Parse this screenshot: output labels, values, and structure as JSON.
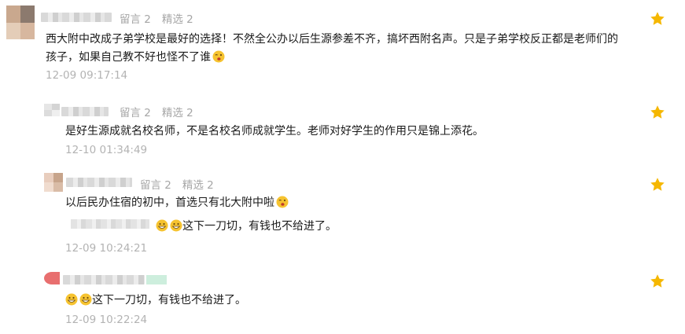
{
  "icons": {
    "star": "star-icon",
    "wink": "wink-emoji-icon",
    "grin": "grin-emoji-icon"
  },
  "colors": {
    "star": "#F5B700",
    "meta": "#A6A6A6",
    "text": "#1A1A1A",
    "emoji": "#F6C330"
  },
  "comments": [
    {
      "meta": {
        "messages": "留言 2",
        "picks": "精选 2"
      },
      "text": "西大附中改成子弟学校是最好的选择！不然全公办以后生源参差不齐，搞坏西附名声。只是子弟学校反正都是老师们的孩子，如果自己教不好也怪不了谁",
      "time": "12-09 09:17:14"
    },
    {
      "meta": {
        "messages": "留言 2",
        "picks": "精选 2"
      },
      "text": "是好生源成就名校名师，不是名校名师成就学生。老师对好学生的作用只是锦上添花。",
      "time": "12-10 01:34:49"
    },
    {
      "meta": {
        "messages": "留言 2",
        "picks": "精选 2"
      },
      "text": "以后民办住宿的初中，首选只有北大附中啦",
      "reply": "这下一刀切，有钱也不给进了。",
      "time": "12-09 10:24:21"
    },
    {
      "text": "这下一刀切，有钱也不给进了。",
      "time": "12-09 10:22:24"
    }
  ]
}
